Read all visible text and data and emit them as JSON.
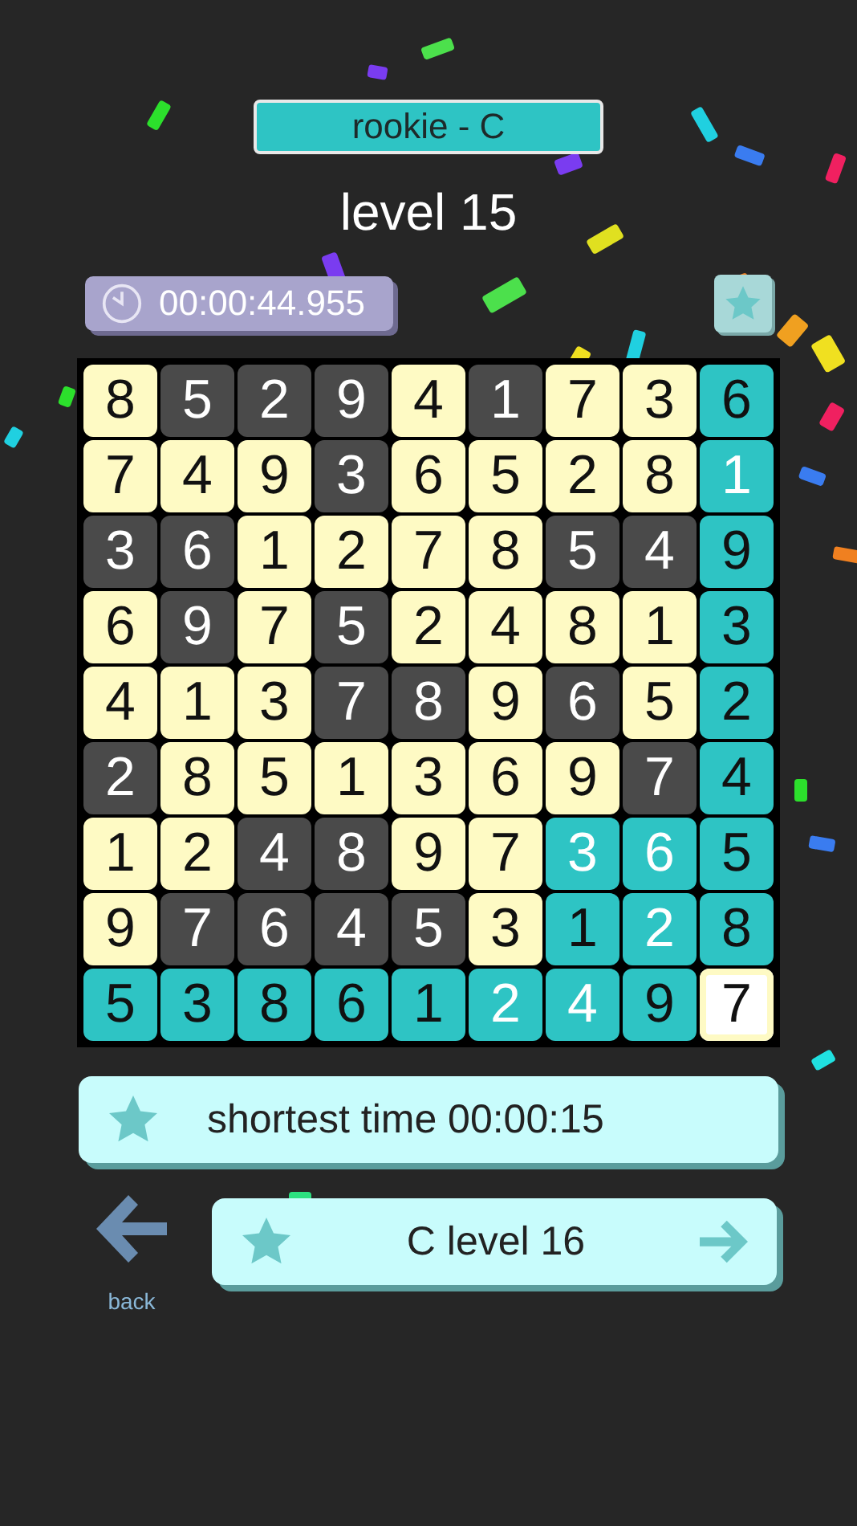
{
  "header": {
    "difficulty": "rookie - C",
    "level_title": "level 15"
  },
  "timer": {
    "time": "00:00:44.955"
  },
  "grid": [
    [
      {
        "digit": "8",
        "kind": "light",
        "selected": false
      },
      {
        "digit": "5",
        "kind": "dark",
        "selected": false
      },
      {
        "digit": "2",
        "kind": "dark",
        "selected": false
      },
      {
        "digit": "9",
        "kind": "dark",
        "selected": false
      },
      {
        "digit": "4",
        "kind": "light",
        "selected": false
      },
      {
        "digit": "1",
        "kind": "dark",
        "selected": false
      },
      {
        "digit": "7",
        "kind": "light",
        "selected": false
      },
      {
        "digit": "3",
        "kind": "light",
        "selected": false
      },
      {
        "digit": "6",
        "kind": "teal",
        "selected": false
      }
    ],
    [
      {
        "digit": "7",
        "kind": "light",
        "selected": false
      },
      {
        "digit": "4",
        "kind": "light",
        "selected": false
      },
      {
        "digit": "9",
        "kind": "light",
        "selected": false
      },
      {
        "digit": "3",
        "kind": "dark",
        "selected": false
      },
      {
        "digit": "6",
        "kind": "light",
        "selected": false
      },
      {
        "digit": "5",
        "kind": "light",
        "selected": false
      },
      {
        "digit": "2",
        "kind": "light",
        "selected": false
      },
      {
        "digit": "8",
        "kind": "light",
        "selected": false
      },
      {
        "digit": "1",
        "kind": "mint",
        "selected": false
      }
    ],
    [
      {
        "digit": "3",
        "kind": "dark",
        "selected": false
      },
      {
        "digit": "6",
        "kind": "dark",
        "selected": false
      },
      {
        "digit": "1",
        "kind": "light",
        "selected": false
      },
      {
        "digit": "2",
        "kind": "light",
        "selected": false
      },
      {
        "digit": "7",
        "kind": "light",
        "selected": false
      },
      {
        "digit": "8",
        "kind": "light",
        "selected": false
      },
      {
        "digit": "5",
        "kind": "dark",
        "selected": false
      },
      {
        "digit": "4",
        "kind": "dark",
        "selected": false
      },
      {
        "digit": "9",
        "kind": "teal",
        "selected": false
      }
    ],
    [
      {
        "digit": "6",
        "kind": "light",
        "selected": false
      },
      {
        "digit": "9",
        "kind": "dark",
        "selected": false
      },
      {
        "digit": "7",
        "kind": "light",
        "selected": false
      },
      {
        "digit": "5",
        "kind": "dark",
        "selected": false
      },
      {
        "digit": "2",
        "kind": "light",
        "selected": false
      },
      {
        "digit": "4",
        "kind": "light",
        "selected": false
      },
      {
        "digit": "8",
        "kind": "light",
        "selected": false
      },
      {
        "digit": "1",
        "kind": "light",
        "selected": false
      },
      {
        "digit": "3",
        "kind": "teal",
        "selected": false
      }
    ],
    [
      {
        "digit": "4",
        "kind": "light",
        "selected": false
      },
      {
        "digit": "1",
        "kind": "light",
        "selected": false
      },
      {
        "digit": "3",
        "kind": "light",
        "selected": false
      },
      {
        "digit": "7",
        "kind": "dark",
        "selected": false
      },
      {
        "digit": "8",
        "kind": "dark",
        "selected": false
      },
      {
        "digit": "9",
        "kind": "light",
        "selected": false
      },
      {
        "digit": "6",
        "kind": "dark",
        "selected": false
      },
      {
        "digit": "5",
        "kind": "light",
        "selected": false
      },
      {
        "digit": "2",
        "kind": "teal",
        "selected": false
      }
    ],
    [
      {
        "digit": "2",
        "kind": "dark",
        "selected": false
      },
      {
        "digit": "8",
        "kind": "light",
        "selected": false
      },
      {
        "digit": "5",
        "kind": "light",
        "selected": false
      },
      {
        "digit": "1",
        "kind": "light",
        "selected": false
      },
      {
        "digit": "3",
        "kind": "light",
        "selected": false
      },
      {
        "digit": "6",
        "kind": "light",
        "selected": false
      },
      {
        "digit": "9",
        "kind": "light",
        "selected": false
      },
      {
        "digit": "7",
        "kind": "dark",
        "selected": false
      },
      {
        "digit": "4",
        "kind": "teal",
        "selected": false
      }
    ],
    [
      {
        "digit": "1",
        "kind": "light",
        "selected": false
      },
      {
        "digit": "2",
        "kind": "light",
        "selected": false
      },
      {
        "digit": "4",
        "kind": "dark",
        "selected": false
      },
      {
        "digit": "8",
        "kind": "dark",
        "selected": false
      },
      {
        "digit": "9",
        "kind": "light",
        "selected": false
      },
      {
        "digit": "7",
        "kind": "light",
        "selected": false
      },
      {
        "digit": "3",
        "kind": "mint",
        "selected": false
      },
      {
        "digit": "6",
        "kind": "mint",
        "selected": false
      },
      {
        "digit": "5",
        "kind": "teal",
        "selected": false
      }
    ],
    [
      {
        "digit": "9",
        "kind": "light",
        "selected": false
      },
      {
        "digit": "7",
        "kind": "dark",
        "selected": false
      },
      {
        "digit": "6",
        "kind": "dark",
        "selected": false
      },
      {
        "digit": "4",
        "kind": "dark",
        "selected": false
      },
      {
        "digit": "5",
        "kind": "dark",
        "selected": false
      },
      {
        "digit": "3",
        "kind": "light",
        "selected": false
      },
      {
        "digit": "1",
        "kind": "teal",
        "selected": false
      },
      {
        "digit": "2",
        "kind": "mint",
        "selected": false
      },
      {
        "digit": "8",
        "kind": "teal",
        "selected": false
      }
    ],
    [
      {
        "digit": "5",
        "kind": "teal",
        "selected": false
      },
      {
        "digit": "3",
        "kind": "teal",
        "selected": false
      },
      {
        "digit": "8",
        "kind": "teal",
        "selected": false
      },
      {
        "digit": "6",
        "kind": "teal",
        "selected": false
      },
      {
        "digit": "1",
        "kind": "teal",
        "selected": false
      },
      {
        "digit": "2",
        "kind": "mint",
        "selected": false
      },
      {
        "digit": "4",
        "kind": "mint",
        "selected": false
      },
      {
        "digit": "9",
        "kind": "teal",
        "selected": false
      },
      {
        "digit": "7",
        "kind": "light",
        "selected": true
      }
    ]
  ],
  "best": {
    "label": "shortest time 00:00:15"
  },
  "back": {
    "label": "back"
  },
  "next": {
    "label": "C level 16"
  }
}
